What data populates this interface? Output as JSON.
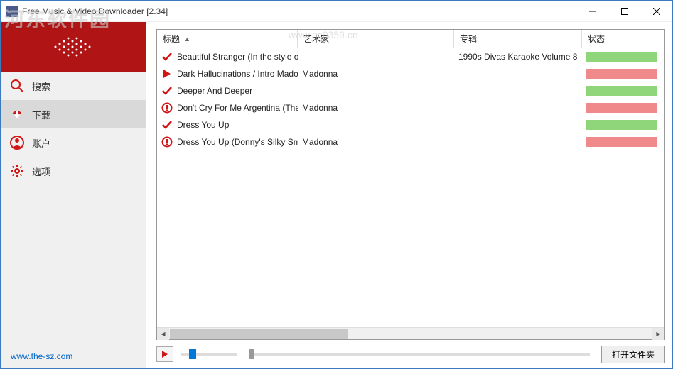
{
  "window": {
    "title": "Free Music & Video Downloader [2.34]"
  },
  "watermark": {
    "text": "河东软件园",
    "url": "www.pc0359.cn"
  },
  "sidebar": {
    "items": [
      {
        "label": "搜索",
        "icon": "search"
      },
      {
        "label": "下载",
        "icon": "download",
        "active": true
      },
      {
        "label": "账户",
        "icon": "account"
      },
      {
        "label": "选项",
        "icon": "options"
      }
    ],
    "link": "www.the-sz.com"
  },
  "table": {
    "columns": {
      "title": "标题",
      "artist": "艺术家",
      "album": "专辑",
      "status": "状态"
    },
    "rows": [
      {
        "icon": "check",
        "title": "Beautiful Stranger (In the style of ...",
        "artist": "",
        "album": "1990s Divas Karaoke Volume 8",
        "status": "green"
      },
      {
        "icon": "play",
        "title": "Dark Hallucinations / Intro Mado...",
        "artist": "Madonna",
        "album": "",
        "status": "red"
      },
      {
        "icon": "check",
        "title": "Deeper And Deeper",
        "artist": "",
        "album": "",
        "status": "green"
      },
      {
        "icon": "error",
        "title": "Don't Cry For Me Argentina (The ...",
        "artist": "Madonna",
        "album": "",
        "status": "red"
      },
      {
        "icon": "check",
        "title": "Dress You Up",
        "artist": "",
        "album": "",
        "status": "green"
      },
      {
        "icon": "error",
        "title": "Dress You Up (Donny's Silky Sm...",
        "artist": "Madonna",
        "album": "",
        "status": "red"
      }
    ]
  },
  "player": {
    "open_folder": "打开文件夹"
  }
}
